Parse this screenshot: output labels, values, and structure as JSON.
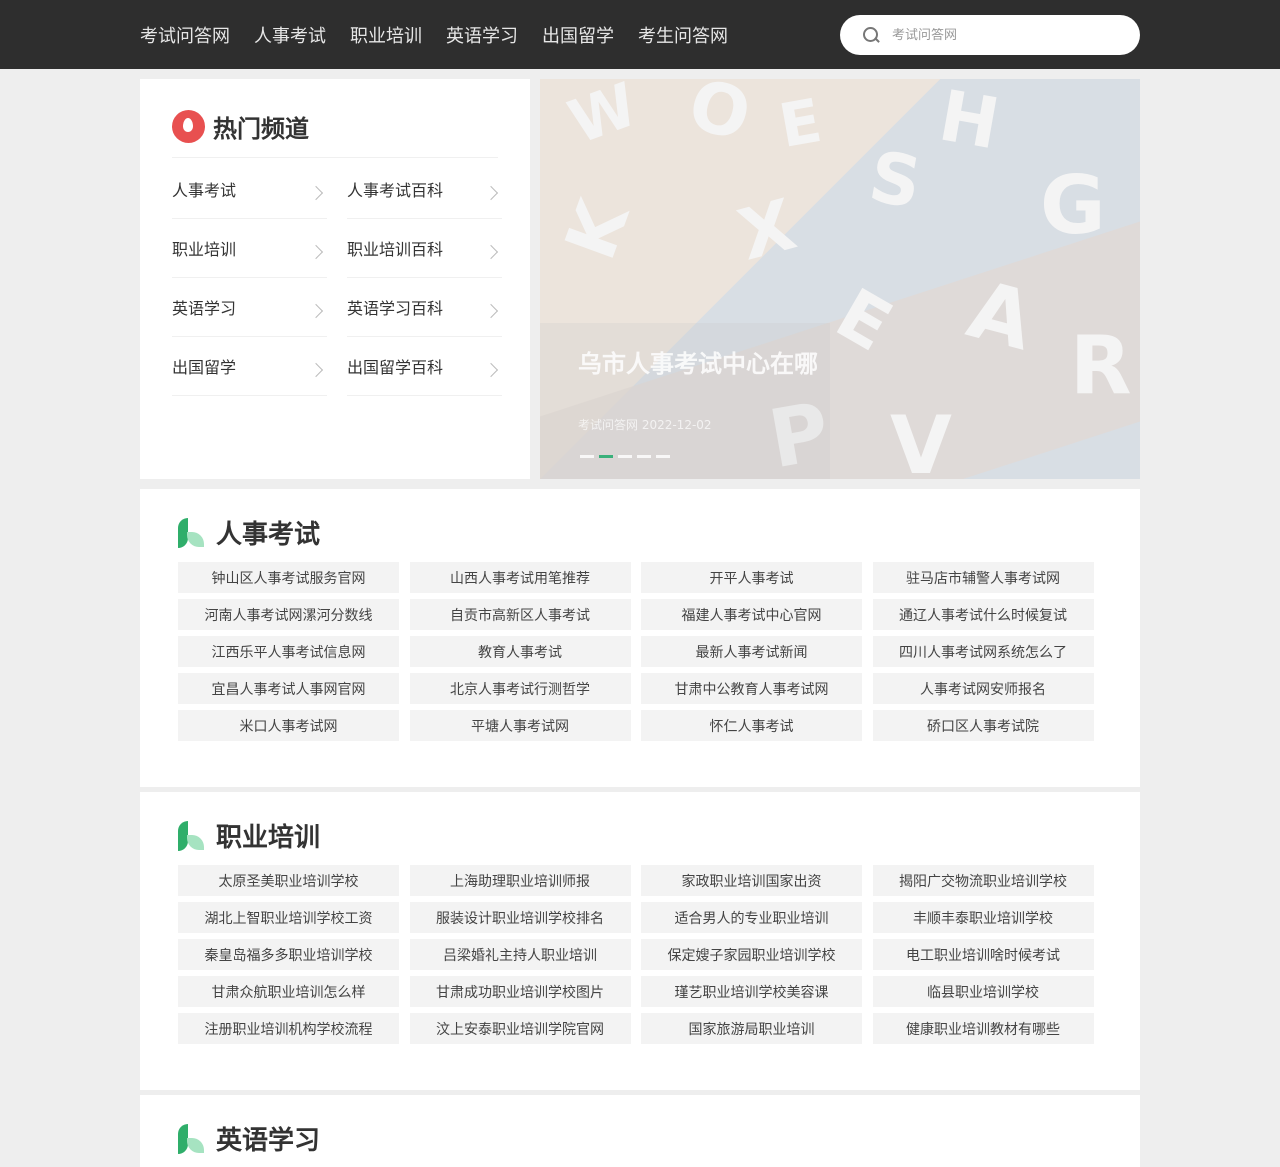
{
  "nav": {
    "items": [
      "考试问答网",
      "人事考试",
      "职业培训",
      "英语学习",
      "出国留学",
      "考生问答网"
    ],
    "search_placeholder": "考试问答网"
  },
  "hot": {
    "title": "热门频道",
    "items": [
      "人事考试",
      "人事考试百科",
      "职业培训",
      "职业培训百科",
      "英语学习",
      "英语学习百科",
      "出国留学",
      "出国留学百科"
    ]
  },
  "banner": {
    "title": "乌市人事考试中心在哪",
    "meta": "考试问答网 2022-12-02",
    "slide_count": 5,
    "active_slide": 2
  },
  "sections": [
    {
      "title": "人事考试",
      "tags": [
        "钟山区人事考试服务官网",
        "山西人事考试用笔推荐",
        "开平人事考试",
        "驻马店市辅警人事考试网",
        "河南人事考试网漯河分数线",
        "自贡市高新区人事考试",
        "福建人事考试中心官网",
        "通辽人事考试什么时候复试",
        "江西乐平人事考试信息网",
        "教育人事考试",
        "最新人事考试新闻",
        "四川人事考试网系统怎么了",
        "宜昌人事考试人事网官网",
        "北京人事考试行测哲学",
        "甘肃中公教育人事考试网",
        "人事考试网安师报名",
        "米口人事考试网",
        "平塘人事考试网",
        "怀仁人事考试",
        "硚口区人事考试院"
      ]
    },
    {
      "title": "职业培训",
      "tags": [
        "太原圣美职业培训学校",
        "上海助理职业培训师报",
        "家政职业培训国家出资",
        "揭阳广交物流职业培训学校",
        "湖北上智职业培训学校工资",
        "服装设计职业培训学校排名",
        "适合男人的专业职业培训",
        "丰顺丰泰职业培训学校",
        "秦皇岛福多多职业培训学校",
        "吕梁婚礼主持人职业培训",
        "保定嫂子家园职业培训学校",
        "电工职业培训啥时候考试",
        "甘肃众航职业培训怎么样",
        "甘肃成功职业培训学校图片",
        "瑾艺职业培训学校美容课",
        "临县职业培训学校",
        "注册职业培训机构学校流程",
        "汶上安泰职业培训学院官网",
        "国家旅游局职业培训",
        "健康职业培训教材有哪些"
      ]
    },
    {
      "title": "英语学习",
      "tags": []
    }
  ],
  "colors": {
    "topbar": "#2e2e2e",
    "accent_green": "#2fae6a",
    "fire_red": "#e85050"
  },
  "icons": {
    "search": "search-icon",
    "hot": "fire-icon",
    "section": "leaf-icon",
    "chevron": "chevron-right-icon"
  }
}
